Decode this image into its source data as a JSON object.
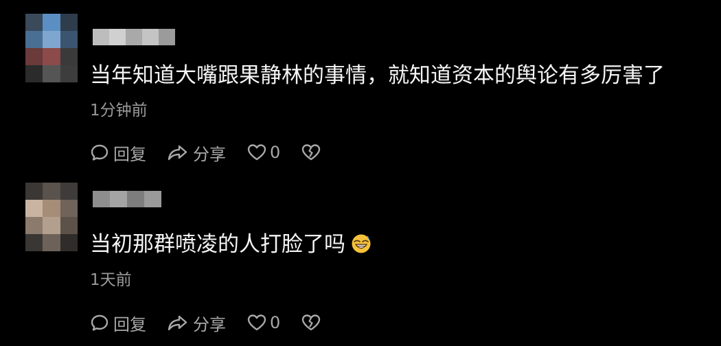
{
  "comments": [
    {
      "text": "当年知道大嘴跟果静林的事情，就知道资本的舆论有多厉害了",
      "time": "1分钟前",
      "reply_label": "回复",
      "share_label": "分享",
      "like_count": "0",
      "avatar_colors": [
        "#3a4a5a",
        "#5b8fc4",
        "#2e3c4c",
        "#4a6f94",
        "#7fa6cf",
        "#3b5570",
        "#6b3a3a",
        "#8c4a4a",
        "#3a3a3a",
        "#2b2b2b",
        "#555555",
        "#3d3d3d"
      ],
      "username_colors": [
        "#bdbdbd",
        "#d0d0d0",
        "#a9a9a9",
        "#c4c4c4",
        "#9b9b9b"
      ]
    },
    {
      "text": "当初那群喷凌的人打脸了吗",
      "time": "1天前",
      "reply_label": "回复",
      "share_label": "分享",
      "like_count": "0",
      "emoji": "grinning-sweat-emoji",
      "avatar_colors": [
        "#3b3734",
        "#5a524c",
        "#3f3b38",
        "#c9b4a2",
        "#a68d78",
        "#6f635a",
        "#8c7a6c",
        "#b39f8d",
        "#5c524a",
        "#3a3633",
        "#6d625a",
        "#2f2c2a"
      ],
      "username_colors": [
        "#8e8e8e",
        "#a4a4a4",
        "#7d7d7d",
        "#9a9a9a"
      ]
    }
  ],
  "colors": {
    "background": "#000000",
    "text": "#f5f5f5",
    "secondary": "#9a9a9a",
    "icon": "#a9a9a9"
  }
}
